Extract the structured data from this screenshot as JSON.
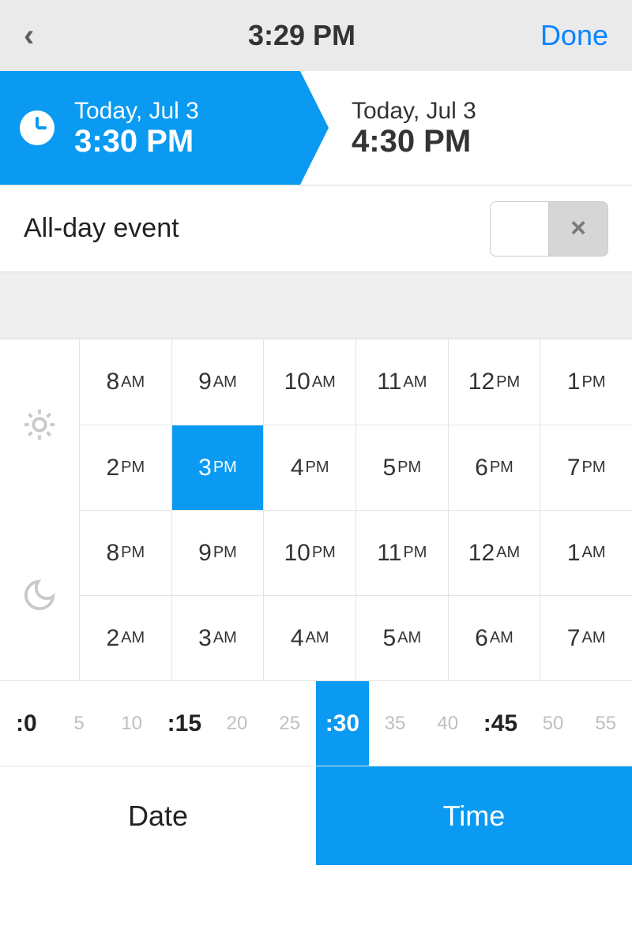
{
  "header": {
    "title": "3:29 PM",
    "done": "Done"
  },
  "range": {
    "start": {
      "date": "Today, Jul 3",
      "time": "3:30 PM"
    },
    "end": {
      "date": "Today, Jul 3",
      "time": "4:30 PM"
    }
  },
  "allday": {
    "label": "All-day event",
    "active": false,
    "off_symbol": "×"
  },
  "hours": {
    "cells": [
      {
        "h": "8",
        "p": "AM"
      },
      {
        "h": "9",
        "p": "AM"
      },
      {
        "h": "10",
        "p": "AM"
      },
      {
        "h": "11",
        "p": "AM"
      },
      {
        "h": "12",
        "p": "PM"
      },
      {
        "h": "1",
        "p": "PM"
      },
      {
        "h": "2",
        "p": "PM"
      },
      {
        "h": "3",
        "p": "PM"
      },
      {
        "h": "4",
        "p": "PM"
      },
      {
        "h": "5",
        "p": "PM"
      },
      {
        "h": "6",
        "p": "PM"
      },
      {
        "h": "7",
        "p": "PM"
      },
      {
        "h": "8",
        "p": "PM"
      },
      {
        "h": "9",
        "p": "PM"
      },
      {
        "h": "10",
        "p": "PM"
      },
      {
        "h": "11",
        "p": "PM"
      },
      {
        "h": "12",
        "p": "AM"
      },
      {
        "h": "1",
        "p": "AM"
      },
      {
        "h": "2",
        "p": "AM"
      },
      {
        "h": "3",
        "p": "AM"
      },
      {
        "h": "4",
        "p": "AM"
      },
      {
        "h": "5",
        "p": "AM"
      },
      {
        "h": "6",
        "p": "AM"
      },
      {
        "h": "7",
        "p": "AM"
      }
    ],
    "selected_index": 7
  },
  "minutes": {
    "cells": [
      {
        "label": ":0",
        "major": true
      },
      {
        "label": "5",
        "major": false
      },
      {
        "label": "10",
        "major": false
      },
      {
        "label": ":15",
        "major": true
      },
      {
        "label": "20",
        "major": false
      },
      {
        "label": "25",
        "major": false
      },
      {
        "label": ":30",
        "major": true
      },
      {
        "label": "35",
        "major": false
      },
      {
        "label": "40",
        "major": false
      },
      {
        "label": ":45",
        "major": true
      },
      {
        "label": "50",
        "major": false
      },
      {
        "label": "55",
        "major": false
      }
    ],
    "selected_index": 6
  },
  "tabs": {
    "date": "Date",
    "time": "Time",
    "active": "time"
  },
  "colors": {
    "accent": "#0A9AF2",
    "header_bg": "#eaeaea"
  }
}
